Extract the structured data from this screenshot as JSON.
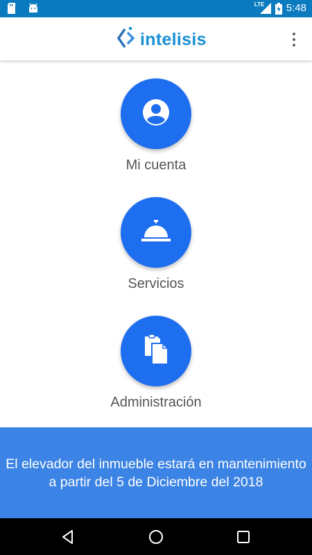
{
  "status_bar": {
    "time": "5:48",
    "network": "LTE",
    "icons": [
      "sd-card-icon",
      "android-icon",
      "signal-icon",
      "battery-icon"
    ]
  },
  "app_bar": {
    "logo_text": "intelisis",
    "menu_icon": "overflow-menu-icon"
  },
  "actions": [
    {
      "label": "Mi cuenta",
      "icon": "account-icon"
    },
    {
      "label": "Servicios",
      "icon": "service-bell-icon"
    },
    {
      "label": "Administración",
      "icon": "documents-icon"
    }
  ],
  "banner": {
    "message": "El elevador del inmueble estará en mantenimiento a partir del 5 de Diciembre del 2018"
  },
  "nav_bar": {
    "icons": [
      "back-icon",
      "home-icon",
      "recents-icon"
    ]
  },
  "colors": {
    "status_bar": "#0a7bbf",
    "accent": "#1e6ef0",
    "banner": "#3b83e4",
    "logo": "#1a8fd6"
  }
}
